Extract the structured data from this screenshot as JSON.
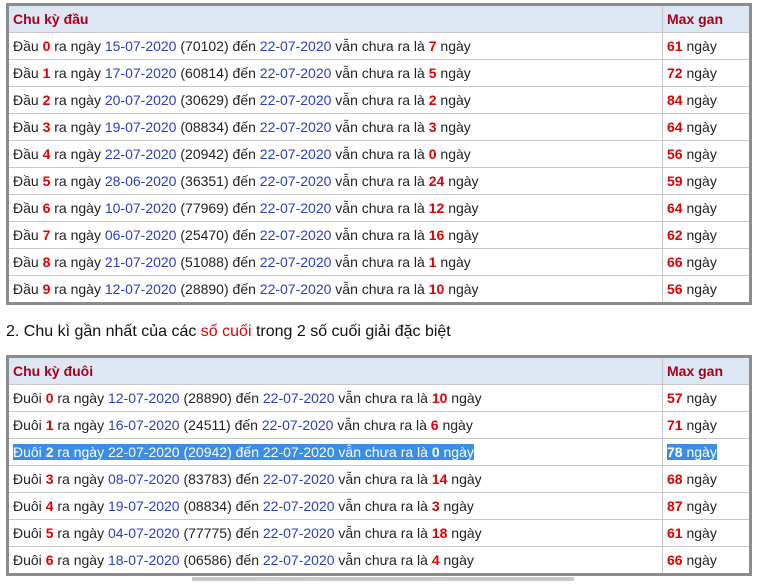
{
  "table1": {
    "header_left": "Chu kỳ đầu",
    "header_right": "Max gan",
    "rows": [
      {
        "prefix": "Đầu",
        "digit": "0",
        "t1": "ra ngày",
        "date1": "15-07-2020",
        "code": "(70102)",
        "t2": "đến",
        "date2": "22-07-2020",
        "t3": "vẫn chưa ra là",
        "days": "7",
        "t4": "ngày",
        "max": "61",
        "maxunit": "ngày"
      },
      {
        "prefix": "Đầu",
        "digit": "1",
        "t1": "ra ngày",
        "date1": "17-07-2020",
        "code": "(60814)",
        "t2": "đến",
        "date2": "22-07-2020",
        "t3": "vẫn chưa ra là",
        "days": "5",
        "t4": "ngày",
        "max": "72",
        "maxunit": "ngày"
      },
      {
        "prefix": "Đầu",
        "digit": "2",
        "t1": "ra ngày",
        "date1": "20-07-2020",
        "code": "(30629)",
        "t2": "đến",
        "date2": "22-07-2020",
        "t3": "vẫn chưa ra là",
        "days": "2",
        "t4": "ngày",
        "max": "84",
        "maxunit": "ngày"
      },
      {
        "prefix": "Đầu",
        "digit": "3",
        "t1": "ra ngày",
        "date1": "19-07-2020",
        "code": "(08834)",
        "t2": "đến",
        "date2": "22-07-2020",
        "t3": "vẫn chưa ra là",
        "days": "3",
        "t4": "ngày",
        "max": "64",
        "maxunit": "ngày"
      },
      {
        "prefix": "Đầu",
        "digit": "4",
        "t1": "ra ngày",
        "date1": "22-07-2020",
        "code": "(20942)",
        "t2": "đến",
        "date2": "22-07-2020",
        "t3": "vẫn chưa ra là",
        "days": "0",
        "t4": "ngày",
        "max": "56",
        "maxunit": "ngày"
      },
      {
        "prefix": "Đầu",
        "digit": "5",
        "t1": "ra ngày",
        "date1": "28-06-2020",
        "code": "(36351)",
        "t2": "đến",
        "date2": "22-07-2020",
        "t3": "vẫn chưa ra là",
        "days": "24",
        "t4": "ngày",
        "max": "59",
        "maxunit": "ngày"
      },
      {
        "prefix": "Đầu",
        "digit": "6",
        "t1": "ra ngày",
        "date1": "10-07-2020",
        "code": "(77969)",
        "t2": "đến",
        "date2": "22-07-2020",
        "t3": "vẫn chưa ra là",
        "days": "12",
        "t4": "ngày",
        "max": "64",
        "maxunit": "ngày"
      },
      {
        "prefix": "Đầu",
        "digit": "7",
        "t1": "ra ngày",
        "date1": "06-07-2020",
        "code": "(25470)",
        "t2": "đến",
        "date2": "22-07-2020",
        "t3": "vẫn chưa ra là",
        "days": "16",
        "t4": "ngày",
        "max": "62",
        "maxunit": "ngày"
      },
      {
        "prefix": "Đầu",
        "digit": "8",
        "t1": "ra ngày",
        "date1": "21-07-2020",
        "code": "(51088)",
        "t2": "đến",
        "date2": "22-07-2020",
        "t3": "vẫn chưa ra là",
        "days": "1",
        "t4": "ngày",
        "max": "66",
        "maxunit": "ngày"
      },
      {
        "prefix": "Đầu",
        "digit": "9",
        "t1": "ra ngày",
        "date1": "12-07-2020",
        "code": "(28890)",
        "t2": "đến",
        "date2": "22-07-2020",
        "t3": "vẫn chưa ra là",
        "days": "10",
        "t4": "ngày",
        "max": "56",
        "maxunit": "ngày"
      }
    ]
  },
  "section2": {
    "title_before": "2. Chu kì gần nhất của các",
    "title_highlight": "số cuối",
    "title_after": "trong 2 số cuối giải đặc biệt"
  },
  "table2": {
    "header_left": "Chu kỳ đuôi",
    "header_right": "Max gan",
    "rows": [
      {
        "prefix": "Đuôi",
        "digit": "0",
        "t1": "ra ngày",
        "date1": "12-07-2020",
        "code": "(28890)",
        "t2": "đến",
        "date2": "22-07-2020",
        "t3": "vẫn chưa ra là",
        "days": "10",
        "t4": "ngày",
        "max": "57",
        "maxunit": "ngày"
      },
      {
        "prefix": "Đuôi",
        "digit": "1",
        "t1": "ra ngày",
        "date1": "16-07-2020",
        "code": "(24511)",
        "t2": "đến",
        "date2": "22-07-2020",
        "t3": "vẫn chưa ra là",
        "days": "6",
        "t4": "ngày",
        "max": "71",
        "maxunit": "ngày"
      },
      {
        "prefix": "Đuôi",
        "digit": "2",
        "t1": "ra ngày",
        "date1": "22-07-2020",
        "code": "(20942)",
        "t2": "đến",
        "date2": "22-07-2020",
        "t3": "vẫn chưa ra là",
        "days": "0",
        "t4": "ngày",
        "max": "78",
        "maxunit": "ngày"
      },
      {
        "prefix": "Đuôi",
        "digit": "3",
        "t1": "ra ngày",
        "date1": "08-07-2020",
        "code": "(83783)",
        "t2": "đến",
        "date2": "22-07-2020",
        "t3": "vẫn chưa ra là",
        "days": "14",
        "t4": "ngày",
        "max": "68",
        "maxunit": "ngày"
      },
      {
        "prefix": "Đuôi",
        "digit": "4",
        "t1": "ra ngày",
        "date1": "19-07-2020",
        "code": "(08834)",
        "t2": "đến",
        "date2": "22-07-2020",
        "t3": "vẫn chưa ra là",
        "days": "3",
        "t4": "ngày",
        "max": "87",
        "maxunit": "ngày"
      },
      {
        "prefix": "Đuôi",
        "digit": "5",
        "t1": "ra ngày",
        "date1": "04-07-2020",
        "code": "(77775)",
        "t2": "đến",
        "date2": "22-07-2020",
        "t3": "vẫn chưa ra là",
        "days": "18",
        "t4": "ngày",
        "max": "61",
        "maxunit": "ngày"
      },
      {
        "prefix": "Đuôi",
        "digit": "6",
        "t1": "ra ngày",
        "date1": "18-07-2020",
        "code": "(06586)",
        "t2": "đến",
        "date2": "22-07-2020",
        "t3": "vẫn chưa ra là",
        "days": "4",
        "t4": "ngày",
        "max": "66",
        "maxunit": "ngày"
      }
    ]
  },
  "colors": {
    "header_bg": "#dde7f4",
    "header_text": "#a8001a",
    "number_red": "#e00000",
    "date_blue": "#2b3ec4",
    "selection_blue": "#3a8ee6"
  }
}
